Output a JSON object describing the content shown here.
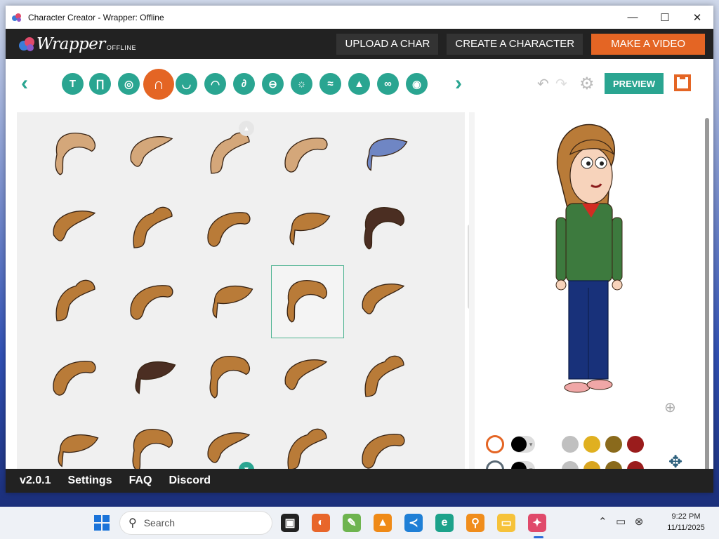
{
  "window": {
    "title": "Character Creator - Wrapper: Offline",
    "controls": {
      "minimize": "—",
      "maximize": "☐",
      "close": "✕"
    }
  },
  "topbar": {
    "logo_main": "Wrapper",
    "logo_sub": "OFFLINE",
    "upload_label": "UPLOAD A CHAR",
    "create_label": "CREATE A CHARACTER",
    "video_label": "MAKE A VIDEO"
  },
  "toolbar": {
    "prev_arrow": "‹",
    "next_arrow": "›",
    "categories": [
      {
        "name": "upper-body",
        "icon": "shirt-icon",
        "glyph": "T"
      },
      {
        "name": "lower-body",
        "icon": "pants-icon",
        "glyph": "∏"
      },
      {
        "name": "head",
        "icon": "head-icon",
        "glyph": "◎"
      },
      {
        "name": "hair",
        "icon": "hair-icon",
        "glyph": "∩"
      },
      {
        "name": "face-shape",
        "icon": "face-icon",
        "glyph": "◡"
      },
      {
        "name": "mouth",
        "icon": "mouth-icon",
        "glyph": "◠"
      },
      {
        "name": "ear",
        "icon": "ear-icon",
        "glyph": "∂"
      },
      {
        "name": "eyes",
        "icon": "eyes-icon",
        "glyph": "⊖"
      },
      {
        "name": "eye-style",
        "icon": "eye-icon",
        "glyph": "☼"
      },
      {
        "name": "eyebrows",
        "icon": "eyebrows-icon",
        "glyph": "≈"
      },
      {
        "name": "nose",
        "icon": "nose-icon",
        "glyph": "▲"
      },
      {
        "name": "glasses",
        "icon": "glasses-icon",
        "glyph": "∞"
      },
      {
        "name": "mask",
        "icon": "mask-icon",
        "glyph": "◉"
      }
    ],
    "selected_category": "hair",
    "undo_icon": "↶",
    "redo_icon": "↷",
    "settings_icon": "⚙",
    "preview_label": "PREVIEW"
  },
  "hair_styles": {
    "selected_index": 13,
    "colors": {
      "hair": "#b97b38",
      "hair_dark": "#4b2e22",
      "hair_light": "#d4a77a",
      "hat": "#6f86c4",
      "outline": "#3a2515"
    },
    "items": [
      {
        "shape": "messy-long",
        "tone": "light"
      },
      {
        "shape": "curly-bob",
        "tone": "light"
      },
      {
        "shape": "updo-bun",
        "tone": "light"
      },
      {
        "shape": "wavy-long",
        "tone": "light"
      },
      {
        "shape": "cap-hat",
        "tone": "hat"
      },
      {
        "shape": "swoop-grey",
        "tone": "normal"
      },
      {
        "shape": "short-swoop",
        "tone": "normal"
      },
      {
        "shape": "ponytail",
        "tone": "normal"
      },
      {
        "shape": "spiky-swoop",
        "tone": "normal"
      },
      {
        "shape": "dark-swoop",
        "tone": "dark"
      },
      {
        "shape": "shaggy",
        "tone": "normal"
      },
      {
        "shape": "pigtails",
        "tone": "normal"
      },
      {
        "shape": "curly-side",
        "tone": "normal"
      },
      {
        "shape": "long-straight",
        "tone": "normal"
      },
      {
        "shape": "side-ponytail",
        "tone": "normal"
      },
      {
        "shape": "short-bob",
        "tone": "normal"
      },
      {
        "shape": "dark-bob",
        "tone": "dark"
      },
      {
        "shape": "spiky-bob",
        "tone": "normal"
      },
      {
        "shape": "clipped-swoop",
        "tone": "normal"
      },
      {
        "shape": "wild-swoop",
        "tone": "normal"
      },
      {
        "shape": "feathered",
        "tone": "normal"
      },
      {
        "shape": "round-bob",
        "tone": "normal"
      },
      {
        "shape": "side-bob",
        "tone": "normal"
      },
      {
        "shape": "tuft-bob",
        "tone": "normal"
      },
      {
        "shape": "fade-swoop",
        "tone": "normal"
      }
    ]
  },
  "character_panel": {
    "skin": "#f7d3bb",
    "jacket": "#3d7a3e",
    "shirt": "#d22c22",
    "pants": "#18317a",
    "shoes": "#f0a7a7",
    "zoom_icon": "⊕",
    "move_icon": "✥"
  },
  "color_swatches": {
    "row1": [
      "#ffffff",
      "#c0c0c0",
      "#e0b020",
      "#8a6a1c",
      "#9a1c1c"
    ],
    "row2": [
      "#ffffff",
      "#c0c0c0",
      "#d9a520",
      "#8a6a1c",
      "#9a1c1c"
    ]
  },
  "footer": {
    "version": "v2.0.1",
    "settings": "Settings",
    "faq": "FAQ",
    "discord": "Discord"
  },
  "taskbar": {
    "search_placeholder": "Search",
    "time": "9:22 PM",
    "date": "11/11/2025",
    "apps": [
      {
        "name": "task-view",
        "color": "#222",
        "glyph": "▣"
      },
      {
        "name": "firefox",
        "color": "#e8662a",
        "glyph": "◐"
      },
      {
        "name": "notepad",
        "color": "#6eb44f",
        "glyph": "✎"
      },
      {
        "name": "vlc",
        "color": "#ef8a17",
        "glyph": "▲"
      },
      {
        "name": "vscode",
        "color": "#1f7fd6",
        "glyph": "≺"
      },
      {
        "name": "edge",
        "color": "#1ca28b",
        "glyph": "e"
      },
      {
        "name": "search-tool",
        "color": "#f08d1c",
        "glyph": "⚲"
      },
      {
        "name": "file-explorer",
        "color": "#f6c23a",
        "glyph": "▭"
      },
      {
        "name": "wrapper-offline",
        "color": "#e04a6b",
        "glyph": "✦"
      }
    ]
  }
}
